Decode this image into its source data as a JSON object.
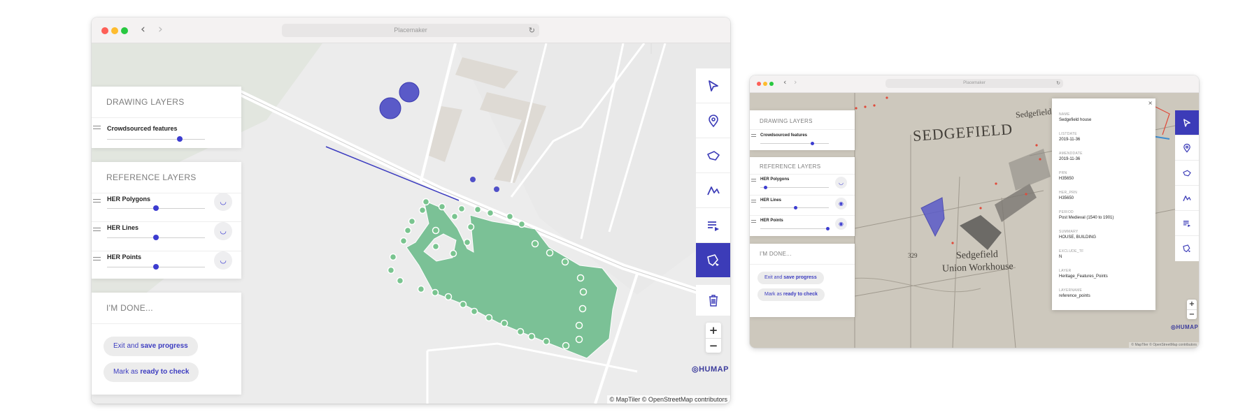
{
  "browser": {
    "url_title": "Placemaker",
    "back_icon": "chevron-left-icon",
    "forward_icon": "chevron-right-icon",
    "reload_icon": "reload-icon"
  },
  "panels": {
    "drawing": {
      "title": "DRAWING LAYERS",
      "layers": [
        {
          "label": "Crowdsourced features",
          "value": 0.74
        }
      ]
    },
    "reference": {
      "title": "REFERENCE LAYERS",
      "layers": [
        {
          "label": "HER Polygons",
          "value": 0.5,
          "visibility_icon": "eye-closed-icon"
        },
        {
          "label": "HER Lines",
          "value": 0.5,
          "visibility_icon": "eye-closed-icon"
        },
        {
          "label": "HER Points",
          "value": 0.5,
          "visibility_icon": "eye-closed-icon"
        }
      ]
    },
    "done": {
      "title": "I'M DONE...",
      "save_prefix": "Exit and",
      "save_strong": "save progress",
      "check_prefix": "Mark as",
      "check_strong": "ready to check"
    }
  },
  "panels2": {
    "reference_values": [
      0.05,
      0.5,
      0.98
    ],
    "reference_icons": [
      "eye-closed-icon",
      "eye-icon",
      "eye-icon"
    ]
  },
  "toolbar": {
    "tools": [
      "select-pointer-icon",
      "place-marker-icon",
      "draw-polygon-icon",
      "draw-line-icon",
      "list-play-icon",
      "edit-polygon-icon"
    ],
    "active_tool": "edit-polygon-icon",
    "delete_icon": "trash-icon"
  },
  "zoom": {
    "in": "+",
    "out": "−"
  },
  "logo": "HUMAP",
  "attribution": "© MapTiler © OpenStreetMap contributors",
  "map_labels": {
    "town": "SEDGEFIELD",
    "town_small": "Sedgefield",
    "workhouse_1": "Sedgefield",
    "workhouse_2": "Union Workhouse",
    "parcel": "329"
  },
  "popup": {
    "close": "×",
    "fields": [
      {
        "key": "NAME",
        "value": "Sedgefield house"
      },
      {
        "key": "LISTDATE",
        "value": "2019-11-36"
      },
      {
        "key": "AMENDDATE",
        "value": "2019-11-36"
      },
      {
        "key": "PRN",
        "value": "H35650"
      },
      {
        "key": "HER_PRN",
        "value": "H35650"
      },
      {
        "key": "PERIOD",
        "value": "Post Medieval (1540 to 1901)"
      },
      {
        "key": "SUMMARY",
        "value": "HOUSE, BUILDING"
      },
      {
        "key": "EXCLUDE_TF",
        "value": "N"
      },
      {
        "key": "LAYER",
        "value": "Heritage_Features_Points"
      },
      {
        "key": "LAYERNAME",
        "value": "reference_points"
      }
    ]
  },
  "colors": {
    "accent": "#3c3cb8",
    "polygon_fill": "#77bf8e",
    "polygon_vertex": "#5cb874",
    "shape_blue": "#5050c8"
  }
}
